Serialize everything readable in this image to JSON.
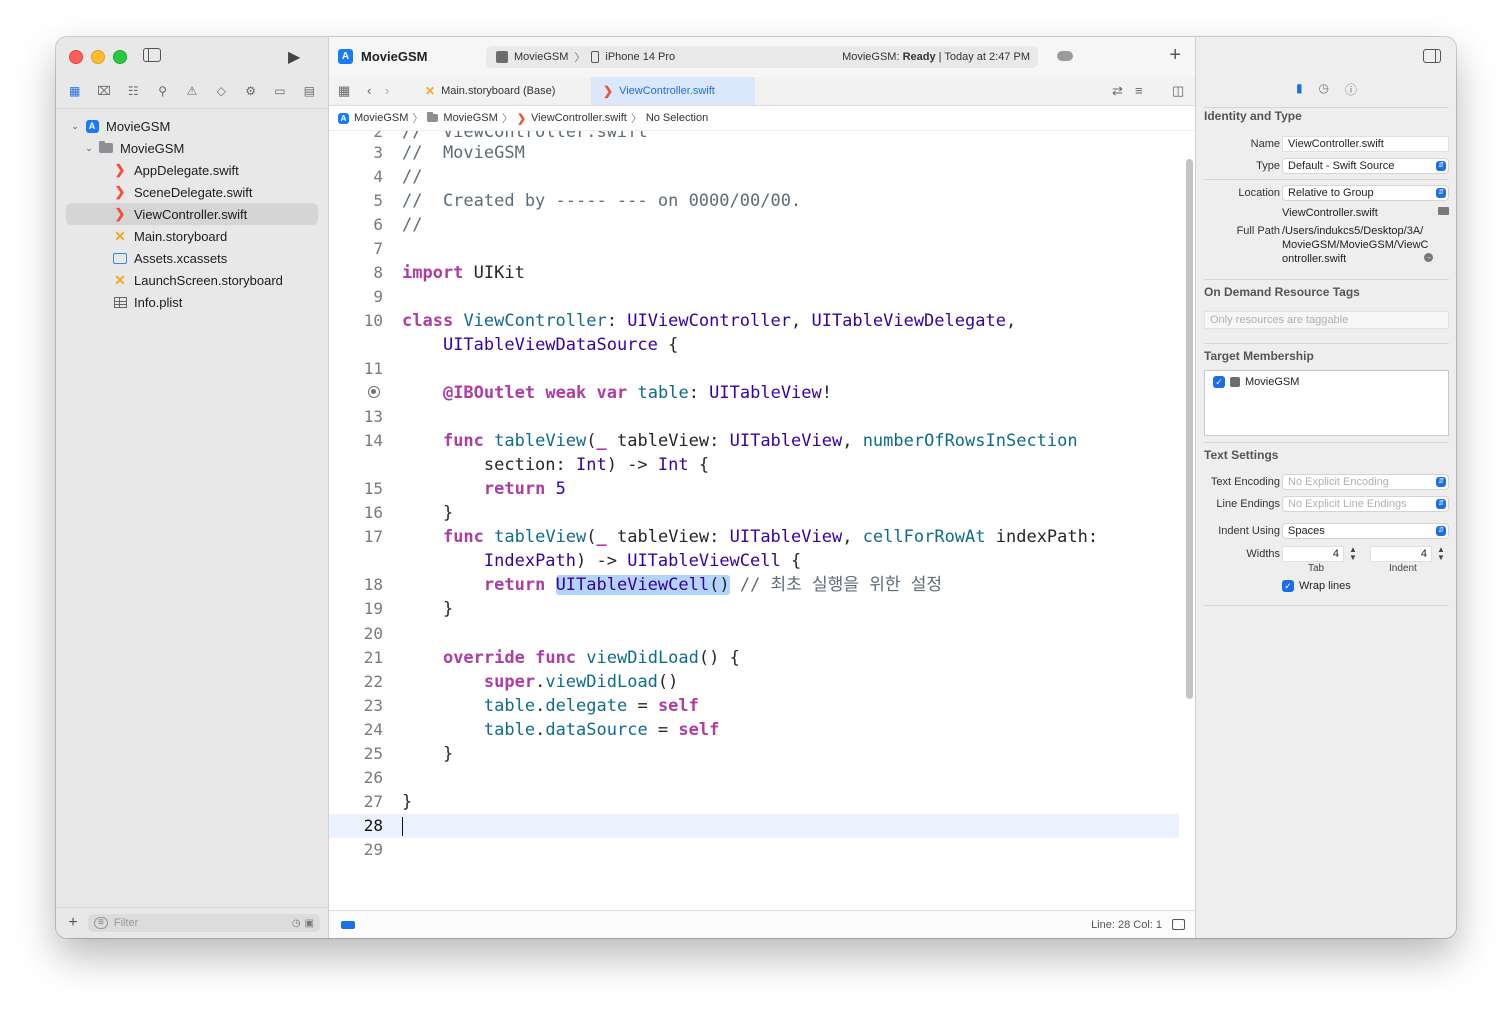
{
  "window": {
    "app_title": "MovieGSM"
  },
  "toolbar": {
    "scheme_app": "MovieGSM",
    "scheme_device": "iPhone 14 Pro",
    "status_prefix": "MovieGSM: ",
    "status_state": "Ready",
    "status_time": " | Today at 2:47 PM"
  },
  "navigator": {
    "items": [
      {
        "label": "MovieGSM",
        "icon": "project-icon",
        "depth": 0
      },
      {
        "label": "MovieGSM",
        "icon": "folder-icon",
        "depth": 1
      },
      {
        "label": "AppDelegate.swift",
        "icon": "swift-file-icon",
        "depth": 2
      },
      {
        "label": "SceneDelegate.swift",
        "icon": "swift-file-icon",
        "depth": 2
      },
      {
        "label": "ViewController.swift",
        "icon": "swift-file-icon",
        "depth": 2,
        "selected": true
      },
      {
        "label": "Main.storyboard",
        "icon": "storyboard-icon",
        "depth": 2
      },
      {
        "label": "Assets.xcassets",
        "icon": "assets-icon",
        "depth": 2
      },
      {
        "label": "LaunchScreen.storyboard",
        "icon": "storyboard-icon",
        "depth": 2
      },
      {
        "label": "Info.plist",
        "icon": "plist-icon",
        "depth": 2
      }
    ],
    "filter_placeholder": "Filter"
  },
  "tabs": [
    {
      "label": "Main.storyboard (Base)",
      "active": false
    },
    {
      "label": "ViewController.swift",
      "active": true
    }
  ],
  "breadcrumb": [
    "MovieGSM",
    "MovieGSM",
    "ViewController.swift",
    "No Selection"
  ],
  "editor": {
    "current_line": 28,
    "partial_top_line": "//  ViewController.swift",
    "lines": [
      {
        "n": "3",
        "code": "//  MovieGSM"
      },
      {
        "n": "4",
        "code": "//"
      },
      {
        "n": "5",
        "code": "//  Created by ----- --- on 0000/00/00."
      },
      {
        "n": "6",
        "code": "//"
      },
      {
        "n": "7",
        "code": ""
      },
      {
        "n": "8",
        "code": "import UIKit"
      },
      {
        "n": "9",
        "code": ""
      },
      {
        "n": "10",
        "code": "class ViewController: UIViewController, UITableViewDelegate,"
      },
      {
        "n": "",
        "code": "    UITableViewDataSource {"
      },
      {
        "n": "11",
        "code": ""
      },
      {
        "n": "",
        "code": "    @IBOutlet weak var table: UITableView!"
      },
      {
        "n": "13",
        "code": ""
      },
      {
        "n": "14",
        "code": "    func tableView(_ tableView: UITableView, numberOfRowsInSection"
      },
      {
        "n": "",
        "code": "        section: Int) -> Int {"
      },
      {
        "n": "15",
        "code": "        return 5"
      },
      {
        "n": "16",
        "code": "    }"
      },
      {
        "n": "17",
        "code": "    func tableView(_ tableView: UITableView, cellForRowAt indexPath:"
      },
      {
        "n": "",
        "code": "        IndexPath) -> UITableViewCell {"
      },
      {
        "n": "18",
        "code": "        return UITableViewCell() // 최초 실행을 위한 설정"
      },
      {
        "n": "19",
        "code": "    }"
      },
      {
        "n": "20",
        "code": ""
      },
      {
        "n": "21",
        "code": "    override func viewDidLoad() {"
      },
      {
        "n": "22",
        "code": "        super.viewDidLoad()"
      },
      {
        "n": "23",
        "code": "        table.delegate = self"
      },
      {
        "n": "24",
        "code": "        table.dataSource = self"
      },
      {
        "n": "25",
        "code": "    }"
      },
      {
        "n": "26",
        "code": ""
      },
      {
        "n": "27",
        "code": "}"
      },
      {
        "n": "28",
        "code": ""
      },
      {
        "n": "29",
        "code": ""
      }
    ],
    "line_col": "Line: 28  Col: 1"
  },
  "inspector": {
    "identity_title": "Identity and Type",
    "name_label": "Name",
    "name_value": "ViewController.swift",
    "type_label": "Type",
    "type_value": "Default - Swift Source",
    "location_label": "Location",
    "location_value": "Relative to Group",
    "location_file": "ViewController.swift",
    "full_path_label": "Full Path",
    "full_path_value": "/Users/indukcs5/Desktop/3A/MovieGSM/MovieGSM/ViewController.swift",
    "odr_title": "On Demand Resource Tags",
    "odr_placeholder": "Only resources are taggable",
    "target_title": "Target Membership",
    "target_name": "MovieGSM",
    "text_title": "Text Settings",
    "encoding_label": "Text Encoding",
    "encoding_value": "No Explicit Encoding",
    "endings_label": "Line Endings",
    "endings_value": "No Explicit Line Endings",
    "indent_label": "Indent Using",
    "indent_value": "Spaces",
    "widths_label": "Widths",
    "tab_width": "4",
    "indent_width": "4",
    "tab_caption": "Tab",
    "indent_caption": "Indent",
    "wrap_label": "Wrap lines"
  },
  "colors": {
    "accent": "#1e6ee6",
    "keyword": "#ad3da4",
    "type": "#3900a0",
    "function": "#0e6c89",
    "comment": "#5d6c79",
    "number": "#1c00cf",
    "selection_highlight": "#b3d4fc"
  }
}
